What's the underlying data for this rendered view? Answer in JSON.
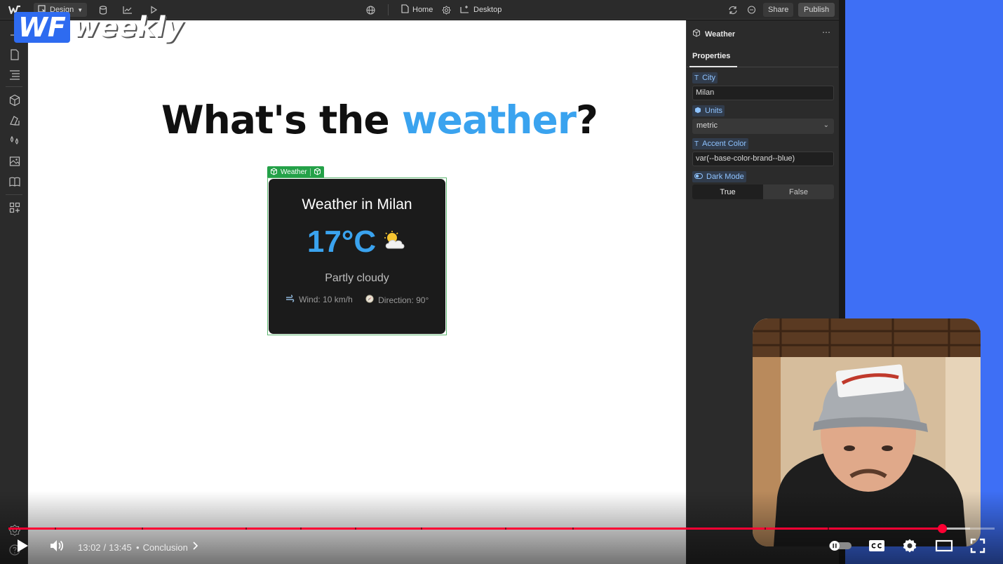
{
  "topbar": {
    "mode_label": "Design",
    "page_label": "Home",
    "breakpoint_label": "Desktop",
    "share_label": "Share",
    "publish_label": "Publish"
  },
  "canvas": {
    "headline_prefix": "What's the ",
    "headline_accent": "weather",
    "headline_suffix": "?",
    "component_tag": "Weather",
    "card": {
      "title": "Weather in Milan",
      "temperature": "17°C",
      "condition": "Partly cloudy",
      "wind": "Wind: 10 km/h",
      "direction": "Direction: 90°"
    }
  },
  "panel": {
    "component_name": "Weather",
    "tab": "Properties",
    "city_label": "City",
    "city_value": "Milan",
    "units_label": "Units",
    "units_value": "metric",
    "accent_label": "Accent Color",
    "accent_value": "var(--base-color-brand--blue)",
    "dark_mode_label": "Dark Mode",
    "dark_mode_options": [
      "True",
      "False"
    ],
    "dark_mode_selected": "True"
  },
  "overlay": {
    "logo_box": "WF",
    "logo_text": "weekly"
  },
  "player": {
    "current_time": "13:02",
    "separator": "/",
    "duration": "13:45",
    "chapter_bullet": "•",
    "chapter": "Conclusion",
    "progress_fraction": 0.947,
    "buffer_fraction": 0.975
  },
  "colors": {
    "accent": "#3aa3ef",
    "progress": "#ff0033",
    "brand_blue": "#3e6ff5",
    "selection_green": "#24a148"
  }
}
